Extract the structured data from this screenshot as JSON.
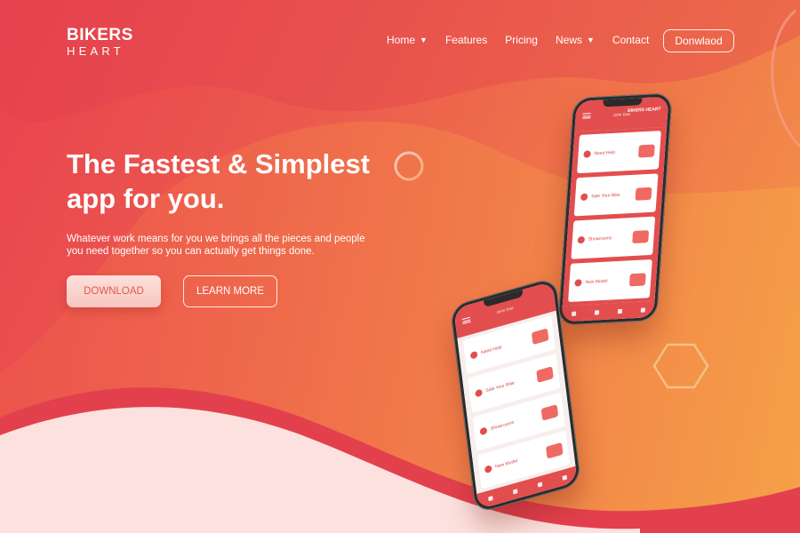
{
  "brand": {
    "line1": "BIKERS",
    "line2": "HEART"
  },
  "nav": {
    "items": [
      {
        "label": "Home",
        "dropdown": true
      },
      {
        "label": "Features",
        "dropdown": false
      },
      {
        "label": "Pricing",
        "dropdown": false
      },
      {
        "label": "News",
        "dropdown": true
      },
      {
        "label": "Contact",
        "dropdown": false
      }
    ],
    "download_label": "Donwlaod"
  },
  "hero": {
    "title_line1": "The Fastest & Simplest",
    "title_line2": "app for you.",
    "subtitle_line1": "Whatever work means for you we brings all the pieces and people",
    "subtitle_line2": "you need together so you can actually get things done.",
    "download_label": "DOWNLOAD",
    "learn_more_label": "LEARN MORE"
  },
  "app_screen": {
    "brand": "BIKERS HEART",
    "user": "John Doe",
    "cards": [
      "Need Help",
      "Sale Your Bike",
      "Showrooms",
      "New Model"
    ]
  },
  "colors": {
    "gradient_start": "#e8424f",
    "gradient_end": "#f49a48",
    "accent": "#e24e4e",
    "button_light": "#fde0dc"
  },
  "icons": {
    "nav_caret": "chevron-down-icon",
    "decor_circle": "ring-decoration",
    "decor_hexagon": "hexagon-decoration"
  }
}
